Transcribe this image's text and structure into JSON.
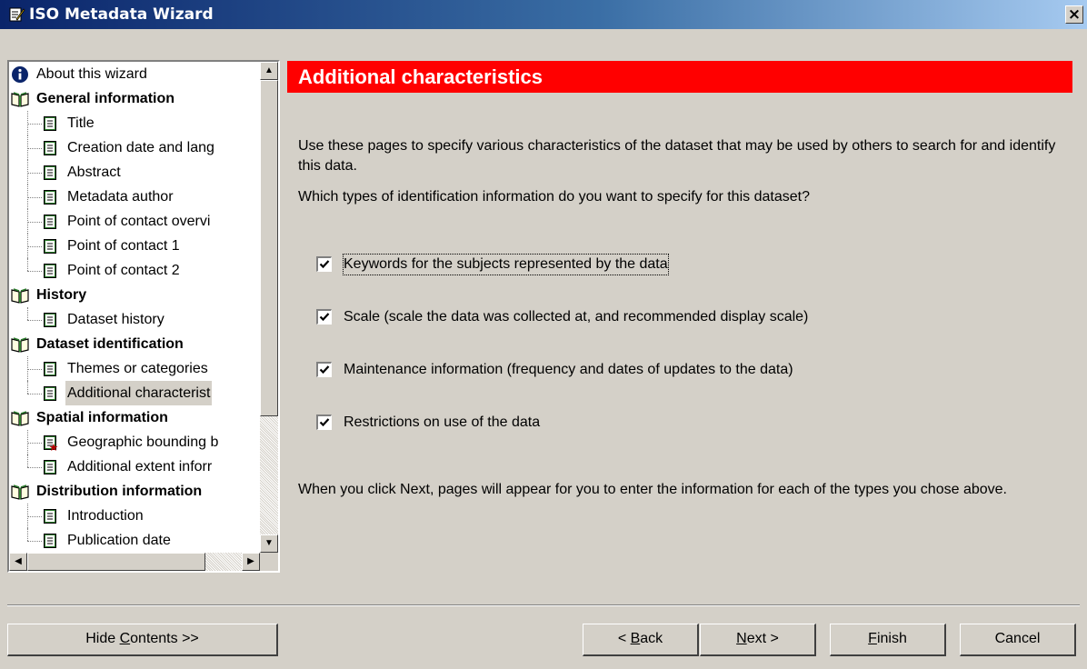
{
  "window": {
    "title": "ISO Metadata Wizard",
    "close_glyph": "×"
  },
  "tree": {
    "items": [
      {
        "label": "About this wizard",
        "icon": "info-icon",
        "level": 0,
        "bold": false
      },
      {
        "label": "General information",
        "icon": "book-icon",
        "level": 0,
        "bold": true
      },
      {
        "label": "Title",
        "icon": "page-icon",
        "level": 1,
        "bold": false
      },
      {
        "label": "Creation date and lang",
        "icon": "page-icon",
        "level": 1,
        "bold": false
      },
      {
        "label": "Abstract",
        "icon": "page-icon",
        "level": 1,
        "bold": false
      },
      {
        "label": "Metadata author",
        "icon": "page-icon",
        "level": 1,
        "bold": false
      },
      {
        "label": "Point of contact overvi",
        "icon": "page-icon",
        "level": 1,
        "bold": false
      },
      {
        "label": "Point of contact 1",
        "icon": "page-icon",
        "level": 1,
        "bold": false
      },
      {
        "label": "Point of contact 2",
        "icon": "page-icon",
        "level": 1,
        "bold": false
      },
      {
        "label": "History",
        "icon": "book-icon",
        "level": 0,
        "bold": true
      },
      {
        "label": "Dataset history",
        "icon": "page-icon",
        "level": 1,
        "bold": false
      },
      {
        "label": "Dataset identification",
        "icon": "book-icon",
        "level": 0,
        "bold": true
      },
      {
        "label": "Themes or categories",
        "icon": "page-icon",
        "level": 1,
        "bold": false
      },
      {
        "label": "Additional characterist",
        "icon": "page-icon",
        "level": 1,
        "bold": false,
        "selected": true
      },
      {
        "label": "Spatial information",
        "icon": "book-icon",
        "level": 0,
        "bold": true
      },
      {
        "label": "Geographic bounding b",
        "icon": "page-required-icon",
        "level": 1,
        "bold": false
      },
      {
        "label": "Additional extent inforr",
        "icon": "page-icon",
        "level": 1,
        "bold": false
      },
      {
        "label": "Distribution information",
        "icon": "book-icon",
        "level": 0,
        "bold": true
      },
      {
        "label": "Introduction",
        "icon": "page-icon",
        "level": 1,
        "bold": false
      },
      {
        "label": "Publication date",
        "icon": "page-icon",
        "level": 1,
        "bold": false
      }
    ]
  },
  "main": {
    "heading": "Additional characteristics",
    "intro": "Use these pages to specify various characteristics of the dataset that may be used by others to search for and identify this data.",
    "question": "Which types of identification information do you want to specify for this dataset?",
    "options": [
      {
        "label": "Keywords for the subjects represented by the data",
        "checked": true
      },
      {
        "label": "Scale (scale the data was collected at, and recommended display scale)",
        "checked": true
      },
      {
        "label": "Maintenance information (frequency and dates of updates to the data)",
        "checked": true
      },
      {
        "label": "Restrictions on use of the data",
        "checked": true
      }
    ],
    "footer_note": "When you click Next, pages will appear for you to enter the information for each of the types you chose above."
  },
  "buttons": {
    "hide_contents": {
      "pre": "Hide ",
      "key": "C",
      "post": "ontents >>"
    },
    "back": {
      "pre": "< ",
      "key": "B",
      "post": "ack"
    },
    "next": {
      "pre": "",
      "key": "N",
      "post": "ext >"
    },
    "finish": {
      "pre": "",
      "key": "F",
      "post": "inish"
    },
    "cancel": "Cancel"
  },
  "colors": {
    "header_bg": "#ff0000",
    "window_bg": "#d4d0c8",
    "titlebar": "#0a246a"
  }
}
